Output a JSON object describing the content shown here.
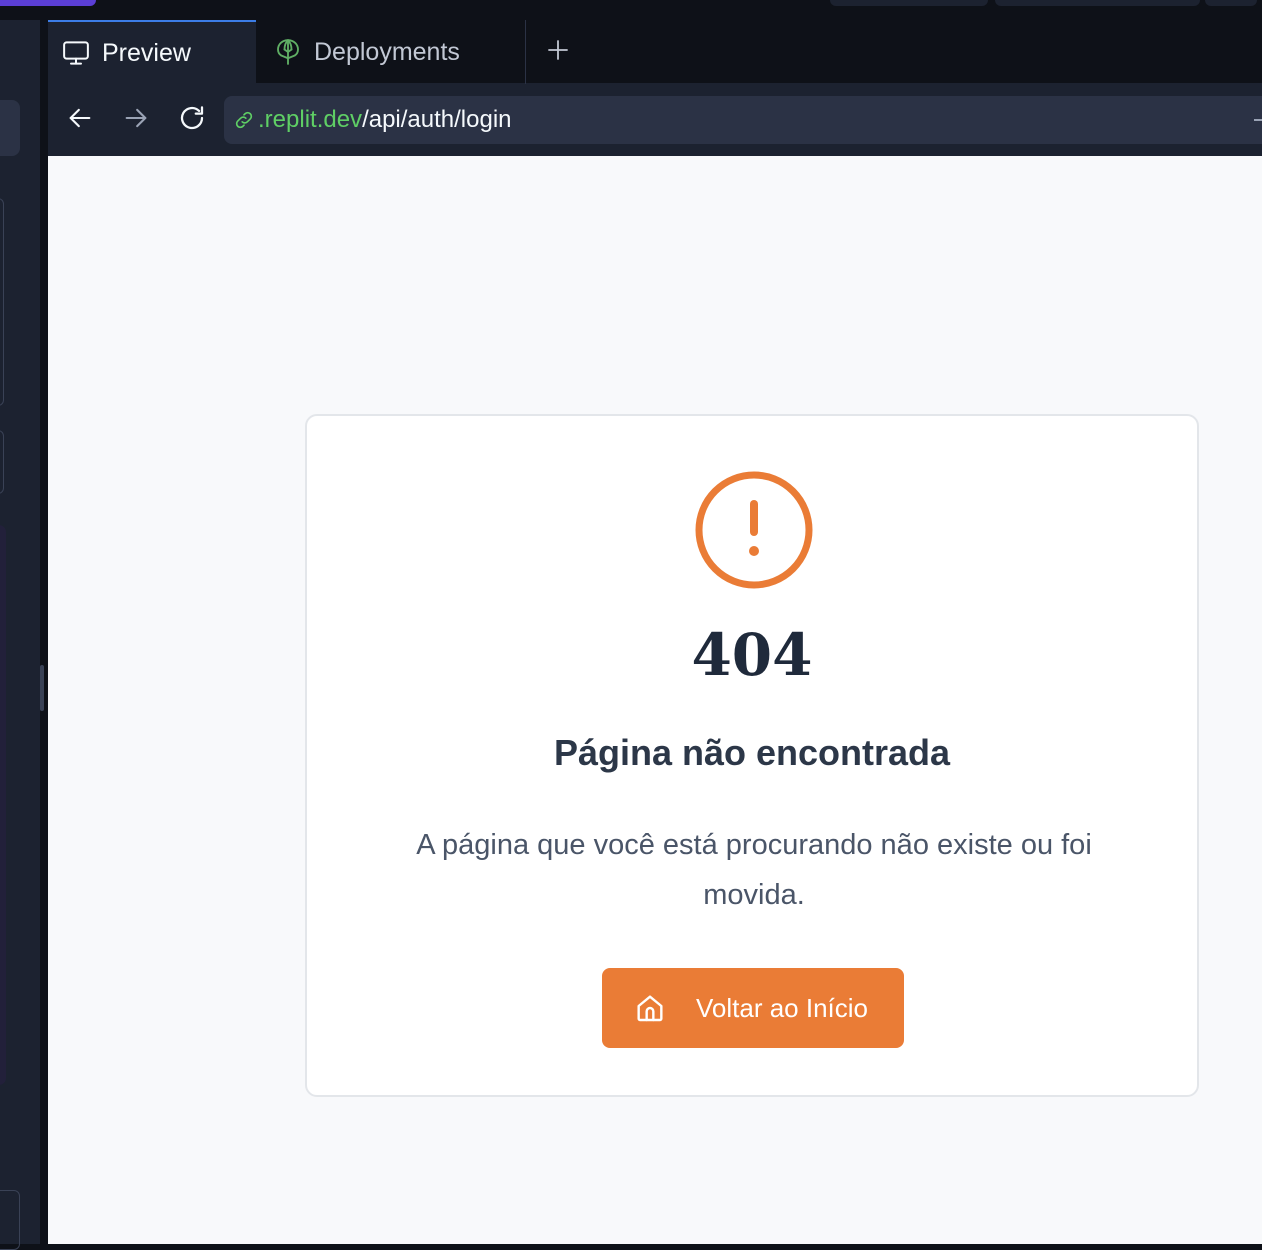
{
  "tabs": [
    {
      "label": "Preview",
      "icon": "monitor-icon",
      "active": true
    },
    {
      "label": "Deployments",
      "icon": "deployments-icon",
      "active": false
    }
  ],
  "add_tab": {
    "icon": "plus-icon"
  },
  "address_bar": {
    "url_host": ".replit.dev",
    "url_path": "/api/auth/login"
  },
  "page": {
    "error_code": "404",
    "title": "Página não encontrada",
    "message": "A página que você está procurando não existe ou foi movida.",
    "button_label": "Voltar ao Início",
    "accent_color": "#ea7c36",
    "icon": "alert-circle-icon"
  },
  "colors": {
    "active_tab_border": "#3c7de6",
    "url_host": "#5fcf65"
  }
}
